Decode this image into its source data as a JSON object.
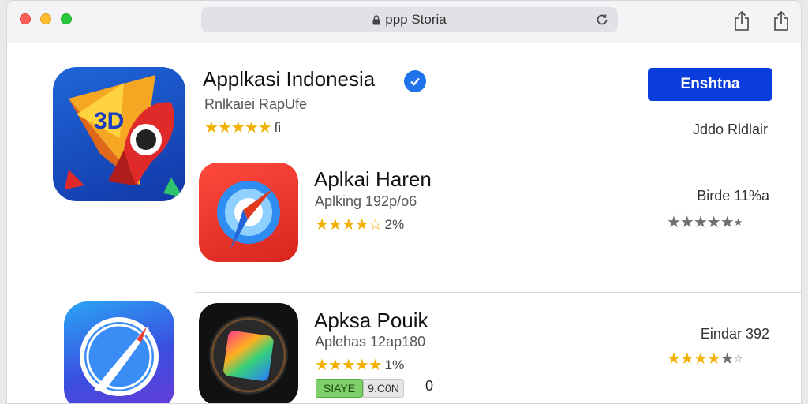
{
  "address_bar": {
    "url_text": "ppp Storia"
  },
  "featured": {
    "title": "Applkasi Indonesia",
    "subtitle": "Rnlkaiei RapUfe",
    "rating_text": "fi",
    "get_button_label": "Enshtna",
    "right_label": "Jddo Rldlair"
  },
  "apps": [
    {
      "title": "Aplkai Haren",
      "subtitle": "Aplking 192p/o6",
      "rating_text": "2%",
      "right_label": "Birde 11%a"
    },
    {
      "title": "Apksa Pouik",
      "subtitle": "Aplehas 12ap180",
      "rating_text": "1%",
      "right_label": "Eindar 392",
      "badge_primary": "SIAYE",
      "badge_secondary": "9.C0N",
      "trailing_text": "0"
    }
  ],
  "colors": {
    "accent": "#0a3ddb",
    "star": "#f2b100",
    "verified": "#1e73ea"
  },
  "icons": [
    "lock-icon",
    "reload-icon",
    "share-icon",
    "tabs-icon",
    "verified-badge-icon",
    "paper-plane-rocket-icon",
    "compass-red-icon",
    "compass-blue-icon",
    "photo-gradient-icon"
  ]
}
